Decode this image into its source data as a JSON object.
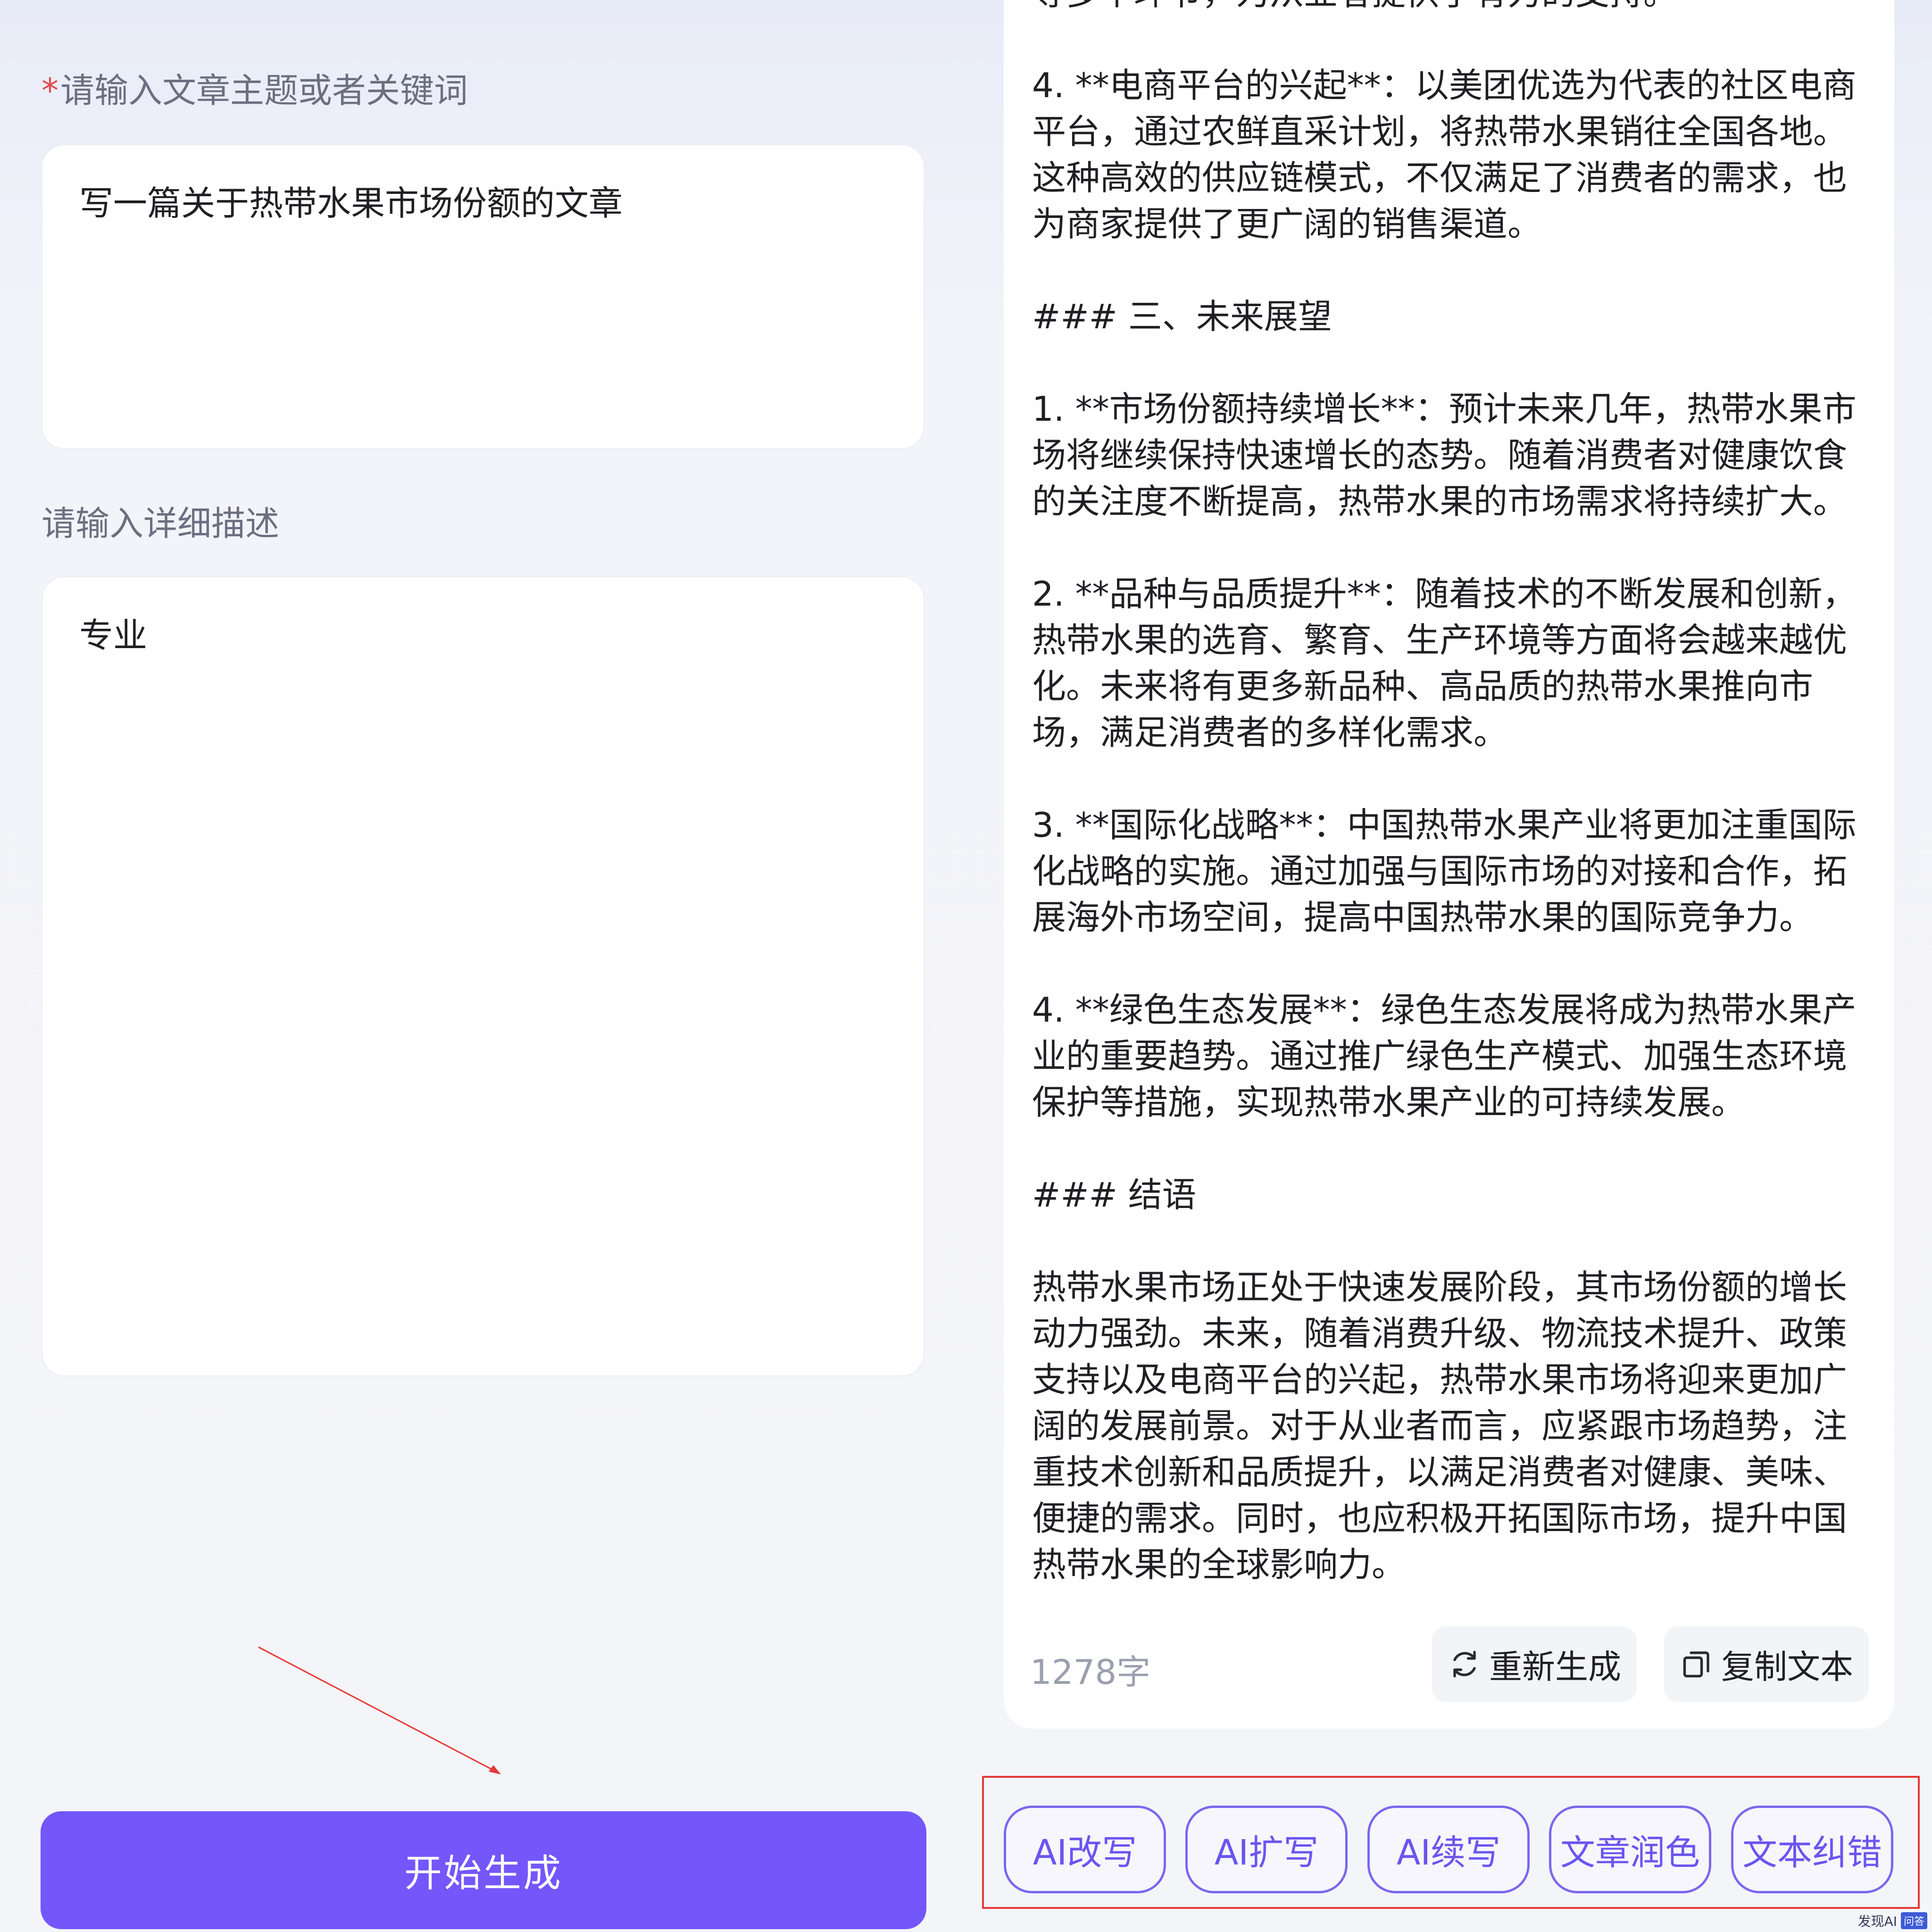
{
  "form": {
    "topic_label": "请输入文章主题或者关键词",
    "topic_value": "写一篇关于热带水果市场份额的文章",
    "detail_label": "请输入详细描述",
    "detail_value": "专业",
    "start_button": "开始生成"
  },
  "article": {
    "paragraphs": [
      "等多个环节，为从业者提供了有力的支持。",
      "4. **电商平台的兴起**：以美团优选为代表的社区电商平台，通过农鲜直采计划，将热带水果销往全国各地。这种高效的供应链模式，不仅满足了消费者的需求，也为商家提供了更广阔的销售渠道。",
      "### 三、未来展望",
      "1. **市场份额持续增长**：预计未来几年，热带水果市场将继续保持快速增长的态势。随着消费者对健康饮食的关注度不断提高，热带水果的市场需求将持续扩大。",
      "2. **品种与品质提升**：随着技术的不断发展和创新，热带水果的选育、繁育、生产环境等方面将会越来越优化。未来将有更多新品种、高品质的热带水果推向市场，满足消费者的多样化需求。",
      "3. **国际化战略**：中国热带水果产业将更加注重国际化战略的实施。通过加强与国际市场的对接和合作，拓展海外市场空间，提高中国热带水果的国际竞争力。",
      "4. **绿色生态发展**：绿色生态发展将成为热带水果产业的重要趋势。通过推广绿色生产模式、加强生态环境保护等措施，实现热带水果产业的可持续发展。",
      "### 结语",
      "热带水果市场正处于快速发展阶段，其市场份额的增长动力强劲。未来，随着消费升级、物流技术提升、政策支持以及电商平台的兴起，热带水果市场将迎来更加广阔的发展前景。对于从业者而言，应紧跟市场趋势，注重技术创新和品质提升，以满足消费者对健康、美味、便捷的需求。同时，也应积极开拓国际市场，提升中国热带水果的全球影响力。"
    ],
    "word_count": "1278字",
    "regenerate_label": "重新生成",
    "copy_label": "复制文本"
  },
  "tools": {
    "items": [
      "AI改写",
      "AI扩写",
      "AI续写",
      "文章润色",
      "文本纠错"
    ]
  },
  "watermark": {
    "text": "发现AI",
    "badge": "问答"
  },
  "colors": {
    "accent": "#7357fb",
    "tool_border": "#7a68ee",
    "highlight_frame": "#e53935",
    "required_mark": "#e5484d"
  }
}
